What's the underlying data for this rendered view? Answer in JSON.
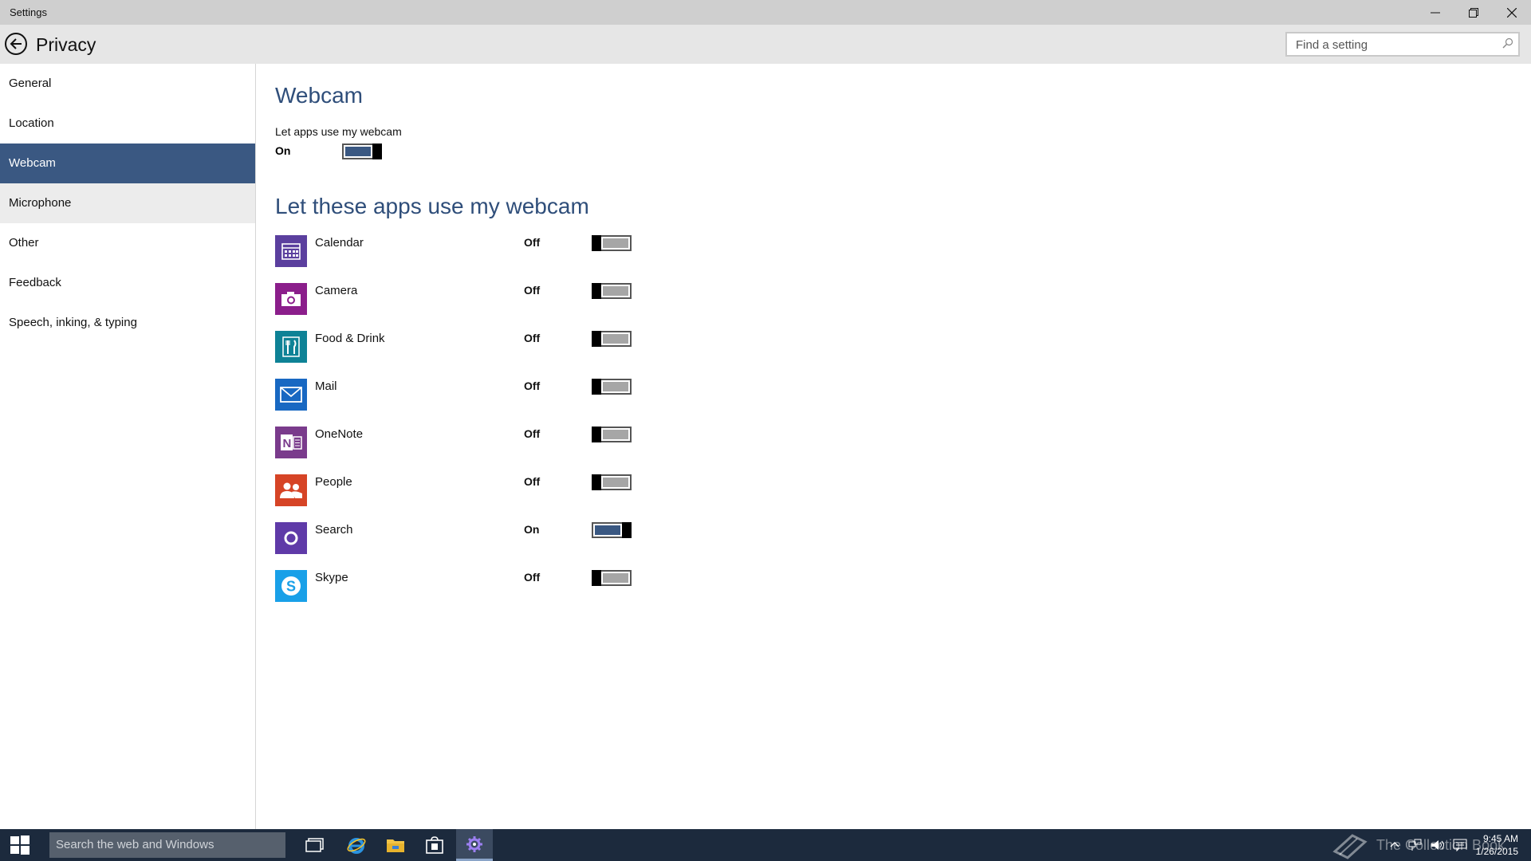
{
  "window": {
    "title": "Settings"
  },
  "header": {
    "title": "Privacy",
    "search_placeholder": "Find a setting"
  },
  "sidebar": {
    "items": [
      {
        "label": "General"
      },
      {
        "label": "Location"
      },
      {
        "label": "Webcam"
      },
      {
        "label": "Microphone"
      },
      {
        "label": "Other"
      },
      {
        "label": "Feedback"
      },
      {
        "label": "Speech, inking, & typing"
      }
    ],
    "selected": "Webcam",
    "hovered": "Microphone"
  },
  "main": {
    "heading": "Webcam",
    "master_label": "Let apps use my webcam",
    "master_state": "On",
    "apps_heading": "Let these apps use my webcam",
    "apps": [
      {
        "name": "Calendar",
        "state": "Off",
        "icon": "calendar-icon",
        "color": "#5b3f9e"
      },
      {
        "name": "Camera",
        "state": "Off",
        "icon": "camera-icon",
        "color": "#8b1e8b"
      },
      {
        "name": "Food & Drink",
        "state": "Off",
        "icon": "food-drink-icon",
        "color": "#0e8296"
      },
      {
        "name": "Mail",
        "state": "Off",
        "icon": "mail-icon",
        "color": "#1868c2"
      },
      {
        "name": "OneNote",
        "state": "Off",
        "icon": "onenote-icon",
        "color": "#7a3b8c"
      },
      {
        "name": "People",
        "state": "Off",
        "icon": "people-icon",
        "color": "#d64426"
      },
      {
        "name": "Search",
        "state": "On",
        "icon": "cortana-icon",
        "color": "#5f3aa8"
      },
      {
        "name": "Skype",
        "state": "Off",
        "icon": "skype-icon",
        "color": "#19a0e8"
      }
    ]
  },
  "taskbar": {
    "search_placeholder": "Search the web and Windows",
    "time": "9:45 AM",
    "date": "1/26/2015",
    "watermark": "The Collection Book"
  },
  "colors": {
    "accent": "#3a5882",
    "heading": "#2f4e7a",
    "taskbar": "#1c2a3d"
  }
}
